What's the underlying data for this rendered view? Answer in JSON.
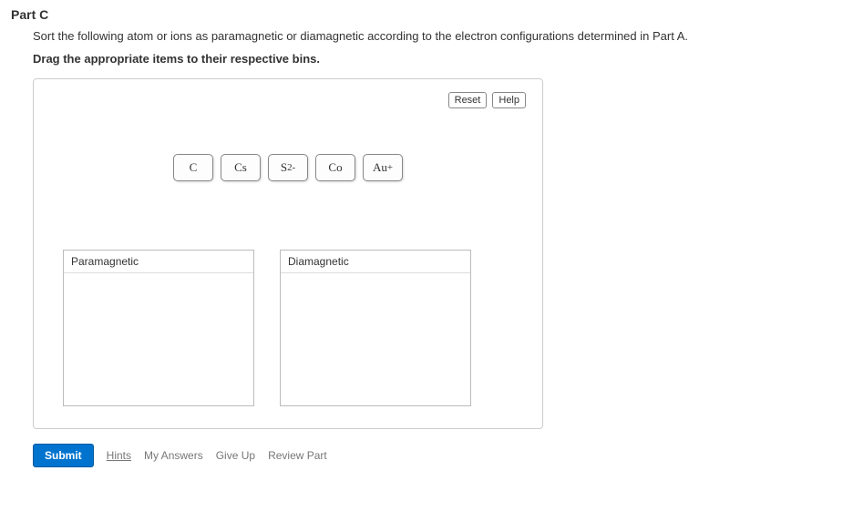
{
  "part": {
    "label": "Part C",
    "question": "Sort the following atom or ions as paramagnetic or diamagnetic according to the electron configurations determined in Part A.",
    "instruction": "Drag the appropriate items to their respective bins."
  },
  "toolbar": {
    "reset": "Reset",
    "help": "Help"
  },
  "items": [
    {
      "html": "C"
    },
    {
      "html": "Cs"
    },
    {
      "html": "S<sup>2-</sup>"
    },
    {
      "html": "Co"
    },
    {
      "html": "Au<sup>+</sup>"
    }
  ],
  "bins": [
    {
      "label": "Paramagnetic"
    },
    {
      "label": "Diamagnetic"
    }
  ],
  "footer": {
    "submit": "Submit",
    "hints": "Hints",
    "my_answers": "My Answers",
    "give_up": "Give Up",
    "review_part": "Review Part"
  }
}
